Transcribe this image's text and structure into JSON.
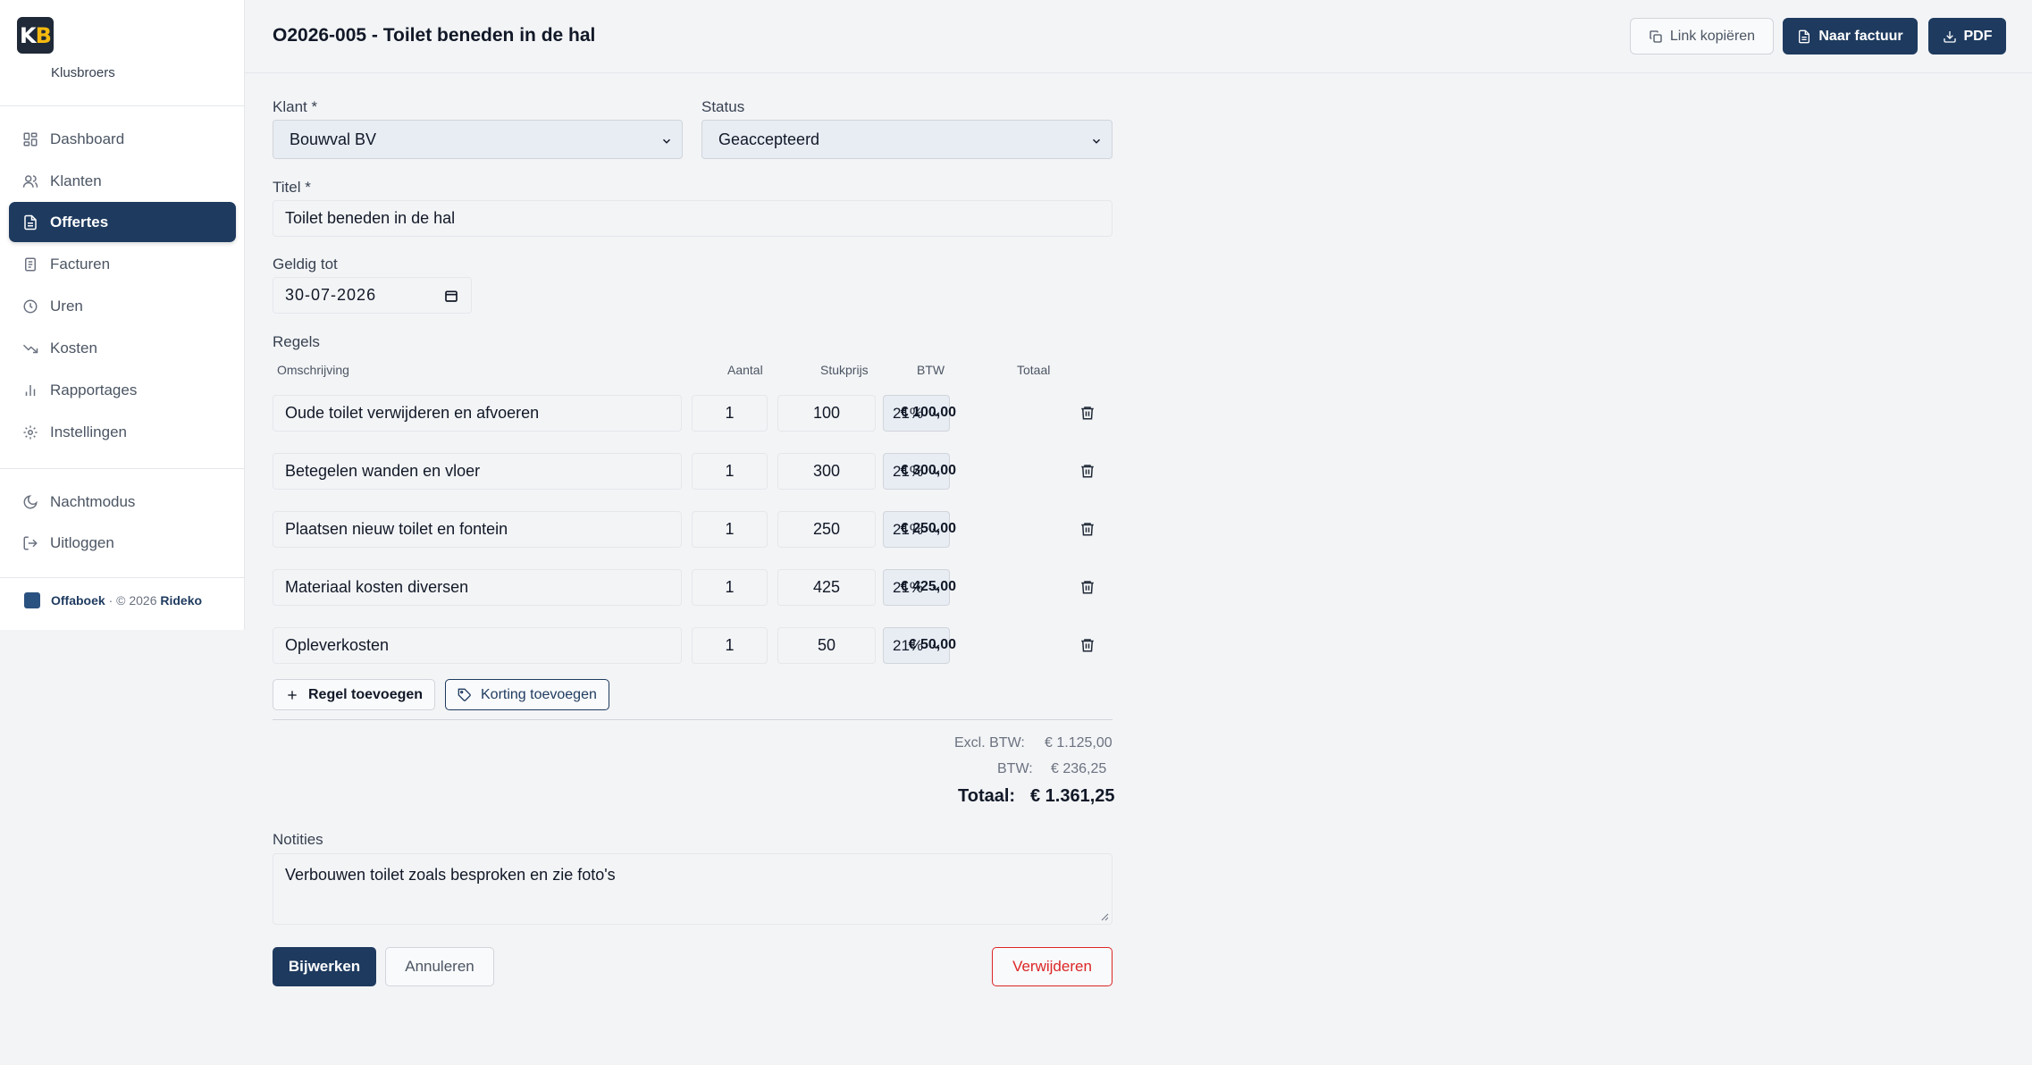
{
  "sidebar": {
    "logo_text_k": "K",
    "logo_text_b": "B",
    "brand": "Klusbroers",
    "items": [
      {
        "label": "Dashboard",
        "icon": "dashboard-icon"
      },
      {
        "label": "Klanten",
        "icon": "users-icon"
      },
      {
        "label": "Offertes",
        "icon": "document-icon",
        "active": true
      },
      {
        "label": "Facturen",
        "icon": "invoice-icon"
      },
      {
        "label": "Uren",
        "icon": "clock-icon"
      },
      {
        "label": "Kosten",
        "icon": "trend-down-icon"
      },
      {
        "label": "Rapportages",
        "icon": "bar-chart-icon"
      },
      {
        "label": "Instellingen",
        "icon": "gear-icon"
      }
    ],
    "secondary": [
      {
        "label": "Nachtmodus",
        "icon": "moon-icon"
      },
      {
        "label": "Uitloggen",
        "icon": "logout-icon"
      }
    ],
    "footer": {
      "product": "Offaboek",
      "copyright": " · © 2026 ",
      "company": "Rideko"
    }
  },
  "header": {
    "title": "O2026-005 - Toilet beneden in de hal",
    "copy_link_label": "Link kopiëren",
    "to_invoice_label": "Naar factuur",
    "pdf_label": "PDF"
  },
  "form": {
    "klant_label": "Klant *",
    "klant_value": "Bouwval BV",
    "status_label": "Status",
    "status_value": "Geaccepteerd",
    "titel_label": "Titel *",
    "titel_value": "Toilet beneden in de hal",
    "geldig_label": "Geldig tot",
    "geldig_value": "30-07-2026"
  },
  "lines": {
    "section_label": "Regels",
    "headers": {
      "desc": "Omschrijving",
      "qty": "Aantal",
      "price": "Stukprijs",
      "vat": "BTW",
      "total": "Totaal"
    },
    "rows": [
      {
        "desc": "Oude toilet verwijderen en afvoeren",
        "qty": "1",
        "price": "100",
        "vat": "21%",
        "total": "€ 100,00"
      },
      {
        "desc": "Betegelen wanden en vloer",
        "qty": "1",
        "price": "300",
        "vat": "21%",
        "total": "€ 300,00"
      },
      {
        "desc": "Plaatsen nieuw toilet en fontein",
        "qty": "1",
        "price": "250",
        "vat": "21%",
        "total": "€ 250,00"
      },
      {
        "desc": "Materiaal kosten diversen",
        "qty": "1",
        "price": "425",
        "vat": "21%",
        "total": "€ 425,00"
      },
      {
        "desc": "Opleverkosten",
        "qty": "1",
        "price": "50",
        "vat": "21%",
        "total": "€ 50,00"
      }
    ],
    "add_line_label": "Regel toevoegen",
    "add_discount_label": "Korting toevoegen"
  },
  "summary": {
    "excl_label": "Excl. BTW:",
    "excl_value": "€ 1.125,00",
    "btw_label": "BTW:",
    "btw_value": "€ 236,25",
    "total_label": "Totaal:",
    "total_value": "€ 1.361,25"
  },
  "notes": {
    "label": "Notities",
    "value": "Verbouwen toilet zoals besproken en zie foto's"
  },
  "actions": {
    "update_label": "Bijwerken",
    "cancel_label": "Annuleren",
    "delete_label": "Verwijderen"
  },
  "colors": {
    "accent": "#1e3a5f",
    "danger": "#dc2626",
    "logo_accent": "#f5b90f"
  }
}
